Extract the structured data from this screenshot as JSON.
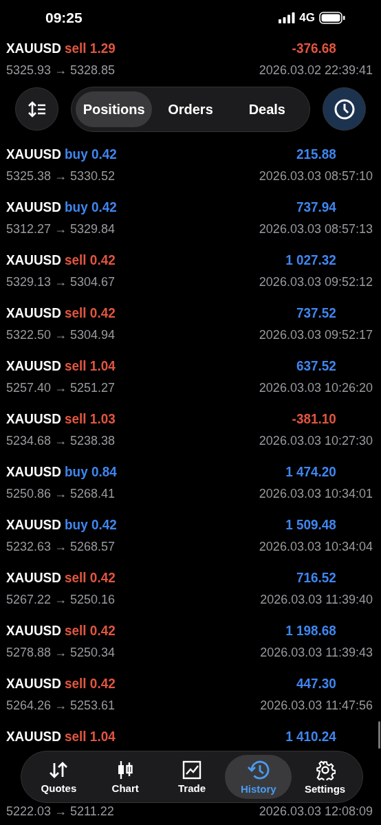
{
  "status_bar": {
    "time": "09:25",
    "network": "4G"
  },
  "header": {
    "tabs": [
      {
        "label": "Positions",
        "selected": true
      },
      {
        "label": "Orders",
        "selected": false
      },
      {
        "label": "Deals",
        "selected": false
      }
    ]
  },
  "deals": [
    {
      "symbol": "XAUUSD",
      "side": "sell",
      "volume": "1.29",
      "profit": "-376.68",
      "loss": true,
      "prices": "5325.93 → 5328.85",
      "time": "2026.03.02 22:39:41"
    },
    {
      "symbol": "XAUUSD",
      "side": "buy",
      "volume": "0.42",
      "profit": "215.88",
      "loss": false,
      "prices": "5325.38 → 5330.52",
      "time": "2026.03.03 08:57:10"
    },
    {
      "symbol": "XAUUSD",
      "side": "buy",
      "volume": "0.42",
      "profit": "737.94",
      "loss": false,
      "prices": "5312.27 → 5329.84",
      "time": "2026.03.03 08:57:13"
    },
    {
      "symbol": "XAUUSD",
      "side": "sell",
      "volume": "0.42",
      "profit": "1 027.32",
      "loss": false,
      "prices": "5329.13 → 5304.67",
      "time": "2026.03.03 09:52:12"
    },
    {
      "symbol": "XAUUSD",
      "side": "sell",
      "volume": "0.42",
      "profit": "737.52",
      "loss": false,
      "prices": "5322.50 → 5304.94",
      "time": "2026.03.03 09:52:17"
    },
    {
      "symbol": "XAUUSD",
      "side": "sell",
      "volume": "1.04",
      "profit": "637.52",
      "loss": false,
      "prices": "5257.40 → 5251.27",
      "time": "2026.03.03 10:26:20"
    },
    {
      "symbol": "XAUUSD",
      "side": "sell",
      "volume": "1.03",
      "profit": "-381.10",
      "loss": true,
      "prices": "5234.68 → 5238.38",
      "time": "2026.03.03 10:27:30"
    },
    {
      "symbol": "XAUUSD",
      "side": "buy",
      "volume": "0.84",
      "profit": "1 474.20",
      "loss": false,
      "prices": "5250.86 → 5268.41",
      "time": "2026.03.03 10:34:01"
    },
    {
      "symbol": "XAUUSD",
      "side": "buy",
      "volume": "0.42",
      "profit": "1 509.48",
      "loss": false,
      "prices": "5232.63 → 5268.57",
      "time": "2026.03.03 10:34:04"
    },
    {
      "symbol": "XAUUSD",
      "side": "sell",
      "volume": "0.42",
      "profit": "716.52",
      "loss": false,
      "prices": "5267.22 → 5250.16",
      "time": "2026.03.03 11:39:40"
    },
    {
      "symbol": "XAUUSD",
      "side": "sell",
      "volume": "0.42",
      "profit": "1 198.68",
      "loss": false,
      "prices": "5278.88 → 5250.34",
      "time": "2026.03.03 11:39:43"
    },
    {
      "symbol": "XAUUSD",
      "side": "sell",
      "volume": "0.42",
      "profit": "447.30",
      "loss": false,
      "prices": "5264.26 → 5253.61",
      "time": "2026.03.03 11:47:56"
    },
    {
      "symbol": "XAUUSD",
      "side": "sell",
      "volume": "1.04",
      "profit": "1 410.24",
      "loss": false
    },
    {
      "prices": "5222.03 → 5211.22",
      "time": "2026.03.03 12:08:09"
    }
  ],
  "nav": [
    {
      "kind": "quotes",
      "label": "Quotes",
      "selected": false
    },
    {
      "kind": "chart",
      "label": "Chart",
      "selected": false
    },
    {
      "kind": "trade",
      "label": "Trade",
      "selected": false
    },
    {
      "kind": "history",
      "label": "History",
      "selected": true
    },
    {
      "kind": "settings",
      "label": "Settings",
      "selected": false
    }
  ]
}
